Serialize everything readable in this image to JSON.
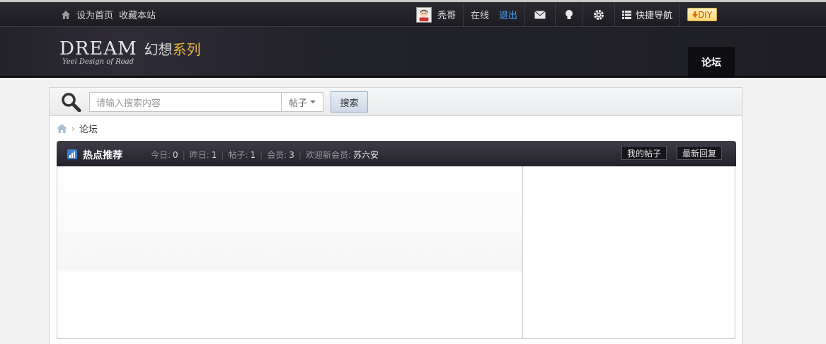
{
  "topbar": {
    "set_home": "设为首页",
    "bookmark": "收藏本站",
    "username": "秃哥",
    "online": "在线",
    "logout": "退出",
    "quick_nav": "快捷导航",
    "diy": "DIY",
    "icons": [
      "home-icon",
      "avatar",
      "mail-icon",
      "bulb-icon",
      "gear-icon",
      "list-icon",
      "arrow-down-icon"
    ]
  },
  "header": {
    "logo_main": "DREAM",
    "logo_cn_a": "幻想",
    "logo_cn_b": "系列",
    "logo_sub": "Yeei Design of Road",
    "nav_forum": "论坛"
  },
  "search": {
    "placeholder": "请输入搜索内容",
    "type": "帖子",
    "button": "搜索"
  },
  "breadcrumb": {
    "current": "论坛"
  },
  "hot": {
    "title": "热点推荐",
    "today_label": "今日:",
    "today_value": "0",
    "yesterday_label": "昨日:",
    "yesterday_value": "1",
    "posts_label": "帖子:",
    "posts_value": "1",
    "members_label": "会员:",
    "members_value": "3",
    "welcome_label": "欢迎新会员:",
    "welcome_name": "苏六安",
    "my_posts": "我的帖子",
    "latest_reply": "最新回复"
  },
  "colors": {
    "topbar": "#1c1c22",
    "header": "#24222a",
    "accent_blue": "#4aa3ff",
    "diy_orange": "#c05a00",
    "hot_head": "#2c2b34"
  }
}
